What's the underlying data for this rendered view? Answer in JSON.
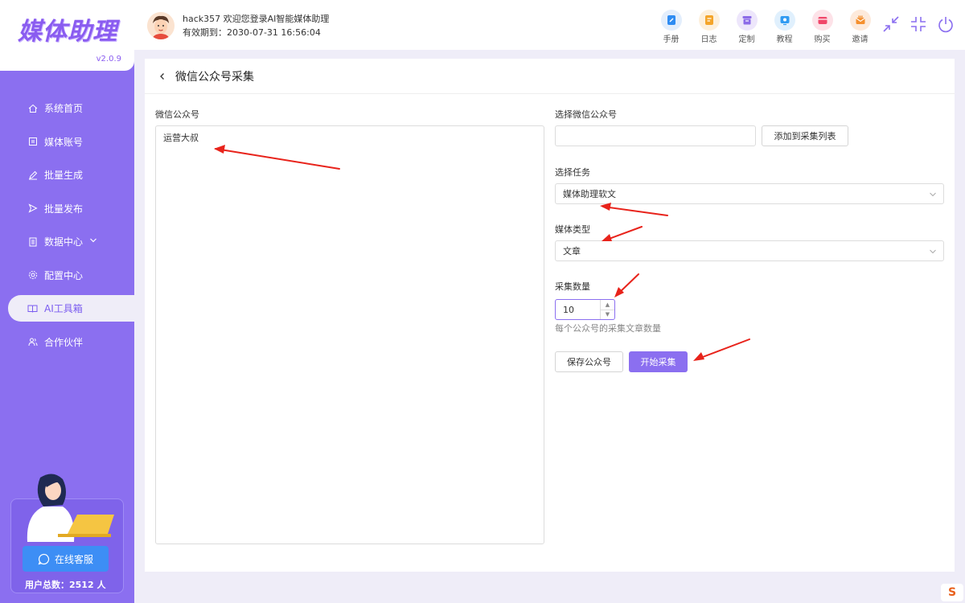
{
  "app": {
    "logo_text": "媒体助理",
    "version": "v2.0.9"
  },
  "header": {
    "welcome_line": "hack357 欢迎您登录AI智能媒体助理",
    "expiry_line": "有效期到：2030-07-31 16:56:04",
    "tools": [
      {
        "label": "手册",
        "icon": "manual-icon",
        "color": "#2f8cf2"
      },
      {
        "label": "日志",
        "icon": "log-icon",
        "color": "#f4a52a"
      },
      {
        "label": "定制",
        "icon": "customize-icon",
        "color": "#8c6be8"
      },
      {
        "label": "教程",
        "icon": "tutorial-icon",
        "color": "#2f9bf2"
      },
      {
        "label": "购买",
        "icon": "purchase-icon",
        "color": "#f0466a"
      },
      {
        "label": "邀请",
        "icon": "invite-icon",
        "color": "#f5902e"
      }
    ]
  },
  "sidebar": {
    "items": [
      {
        "label": "系统首页",
        "icon": "home-icon"
      },
      {
        "label": "媒体账号",
        "icon": "account-icon"
      },
      {
        "label": "批量生成",
        "icon": "edit-icon"
      },
      {
        "label": "批量发布",
        "icon": "send-icon"
      },
      {
        "label": "数据中心",
        "icon": "data-icon"
      },
      {
        "label": "配置中心",
        "icon": "settings-icon"
      },
      {
        "label": "AI工具箱",
        "icon": "toolbox-icon"
      },
      {
        "label": "合作伙伴",
        "icon": "partner-icon"
      }
    ],
    "active_index": 6,
    "support_label": "在线客服",
    "user_count": "用户总数：2512 人"
  },
  "page": {
    "title": "微信公众号采集",
    "left_label": "微信公众号",
    "accounts_text": "运营大叔",
    "select_account_label": "选择微信公众号",
    "select_account_value": "",
    "add_button": "添加到采集列表",
    "task_label": "选择任务",
    "task_value": "媒体助理软文",
    "media_type_label": "媒体类型",
    "media_type_value": "文章",
    "count_label": "采集数量",
    "count_value": "10",
    "count_hint": "每个公众号的采集文章数量",
    "save_button": "保存公众号",
    "start_button": "开始采集"
  },
  "colors": {
    "accent": "#8b6ff0",
    "support_button": "#3d8ef5",
    "annotation_arrow": "#e8231b"
  }
}
